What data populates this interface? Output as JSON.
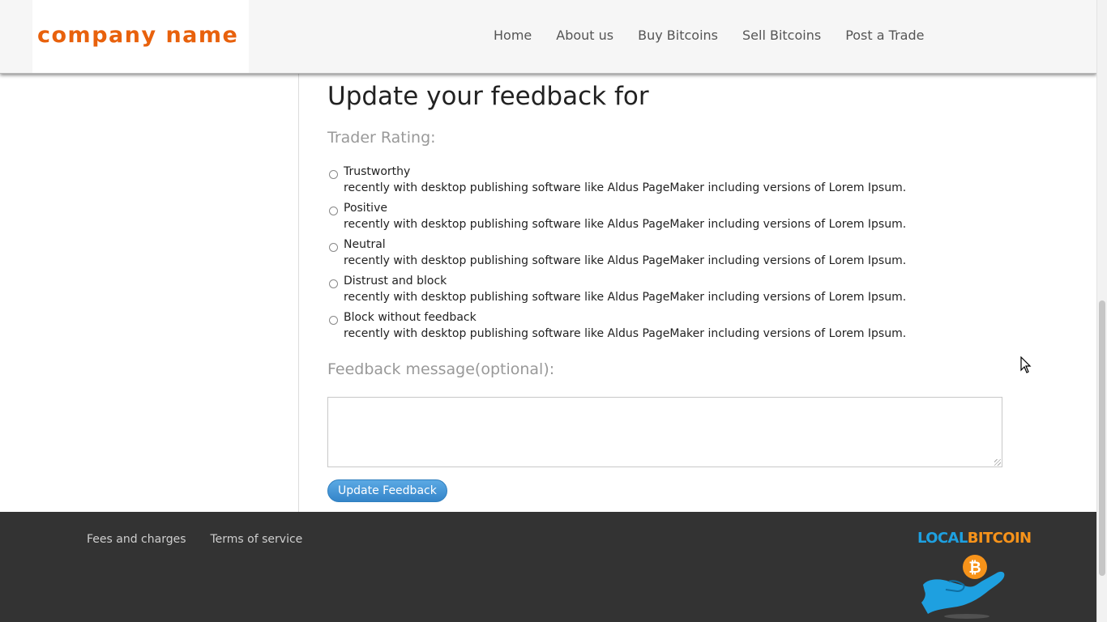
{
  "header": {
    "logo_text": "company name",
    "nav": [
      {
        "label": "Home"
      },
      {
        "label": "About us"
      },
      {
        "label": "Buy Bitcoins"
      },
      {
        "label": "Sell Bitcoins"
      },
      {
        "label": "Post a Trade"
      }
    ]
  },
  "main": {
    "title": "Update your feedback for",
    "rating_label": "Trader Rating:",
    "ratings": [
      {
        "title": "Trustworthy",
        "description": "recently with desktop publishing software like Aldus PageMaker including versions of Lorem Ipsum."
      },
      {
        "title": "Positive",
        "description": "recently with desktop publishing software like Aldus PageMaker including versions of Lorem Ipsum."
      },
      {
        "title": "Neutral",
        "description": "recently with desktop publishing software like Aldus PageMaker including versions of Lorem Ipsum."
      },
      {
        "title": "Distrust and block",
        "description": "recently with desktop publishing software like Aldus PageMaker including versions of Lorem Ipsum."
      },
      {
        "title": "Block without feedback",
        "description": "recently with desktop publishing software like Aldus PageMaker including versions of Lorem Ipsum."
      }
    ],
    "message_label": "Feedback message(optional):",
    "message_value": "",
    "submit_label": "Update Feedback"
  },
  "footer": {
    "links": [
      {
        "label": "Fees and charges"
      },
      {
        "label": "Terms of service"
      }
    ],
    "brand_local": "LOCAL",
    "brand_bitcoin": "BITCOIN"
  },
  "colors": {
    "logo": "#e8610c",
    "footer_bg": "#333333",
    "button": "#3585c9",
    "brand_blue": "#1ea0e0",
    "brand_orange": "#f7931a"
  },
  "icons": [
    "bitcoin-coin-icon",
    "hand-icon",
    "mouse-pointer-icon"
  ]
}
